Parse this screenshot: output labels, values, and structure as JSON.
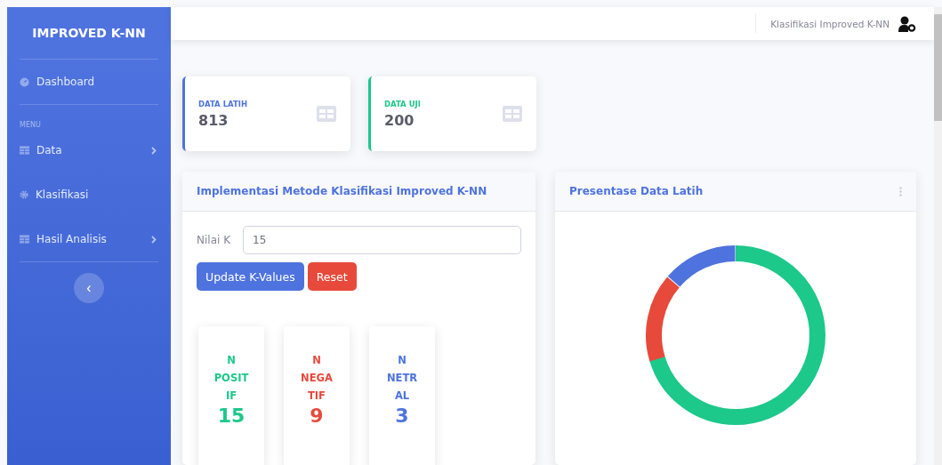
{
  "sidebar": {
    "brand": "IMPROVED K-NN",
    "items": [
      {
        "kind": "link",
        "label": "Dashboard",
        "expandable": false
      },
      {
        "kind": "heading",
        "label": "MENU"
      },
      {
        "kind": "link",
        "label": "Data",
        "expandable": true
      },
      {
        "kind": "link",
        "label": "Klasifikasi",
        "expandable": false
      },
      {
        "kind": "link",
        "label": "Hasil Analisis",
        "expandable": true
      }
    ],
    "toggle": "‹"
  },
  "topbar": {
    "user": "Klasifikasi Improved K-NN"
  },
  "stats": [
    {
      "label": "DATA LATIH",
      "value": "813",
      "color": "#4e73df"
    },
    {
      "label": "DATA UJI",
      "value": "200",
      "color": "#1cc88a"
    }
  ],
  "classify_panel": {
    "title": "Implementasi Metode Klasifikasi Improved K-NN",
    "field_label": "Nilai K",
    "field_value": "15",
    "buttons": [
      {
        "label": "Update K-Values",
        "kind": "primary"
      },
      {
        "label": "Reset",
        "kind": "danger"
      }
    ],
    "counts": [
      {
        "label": "N\nPOSIT\nIF",
        "value": "15",
        "color": "#1cc88a"
      },
      {
        "label": "N\nNEGA\nTIF",
        "value": "9",
        "color": "#e74a3b"
      },
      {
        "label": "N\nNETR\nAL",
        "value": "3",
        "color": "#4e73df"
      }
    ]
  },
  "chart_panel": {
    "title": "Presentase Data Latih"
  }
}
